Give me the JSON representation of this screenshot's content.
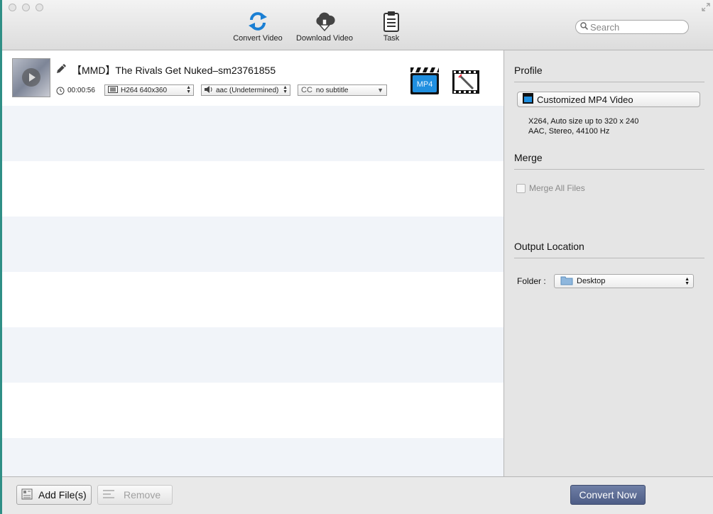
{
  "toolbar": {
    "convert_video": "Convert Video",
    "download_video": "Download Video",
    "task": "Task",
    "search_placeholder": "Search"
  },
  "file": {
    "title": "【MMD】The Rivals Get Nuked–sm23761855",
    "duration": "00:00:56",
    "video_track": "H264 640x360",
    "audio_track": "aac (Undetermined)",
    "subtitle_prefix": "CC",
    "subtitle": "no subtitle",
    "format_badge": "MP4"
  },
  "panel": {
    "profile_title": "Profile",
    "profile_name": "Customized MP4 Video",
    "profile_line1": "X264, Auto size up to 320 x 240",
    "profile_line2": "AAC, Stereo, 44100 Hz",
    "merge_title": "Merge",
    "merge_label": "Merge All Files",
    "output_title": "Output Location",
    "folder_label": "Folder :",
    "folder_value": "Desktop"
  },
  "bottom": {
    "add_files": "Add File(s)",
    "remove": "Remove",
    "convert_now": "Convert Now"
  },
  "colors": {
    "accent_blue": "#1a7fd4",
    "convert_button": "#55648c"
  }
}
